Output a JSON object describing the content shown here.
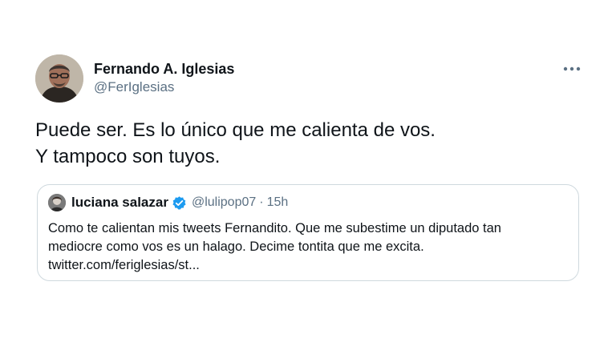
{
  "author": {
    "name": "Fernando A. Iglesias",
    "handle": "@FerIglesias",
    "avatar_icon": "profile-photo"
  },
  "more_icon": "more-horizontal-icon",
  "tweet": {
    "lines": [
      "Puede ser. Es lo único que me calienta de vos.",
      "Y tampoco son tuyos."
    ]
  },
  "quote": {
    "name": "luciana salazar",
    "verified_icon": "verified-badge-icon",
    "handle": "@lulipop07",
    "separator": "·",
    "time": "15h",
    "lines": [
      "Como te calientan mis tweets Fernandito. Que me subestime un diputado tan",
      "mediocre como vos es un halago. Decime tontita que me excita.",
      "twitter.com/feriglesias/st..."
    ]
  },
  "colors": {
    "text": "#0f1419",
    "secondary": "#5b7083",
    "verified": "#1d9bf0",
    "border": "#cfd9de"
  }
}
